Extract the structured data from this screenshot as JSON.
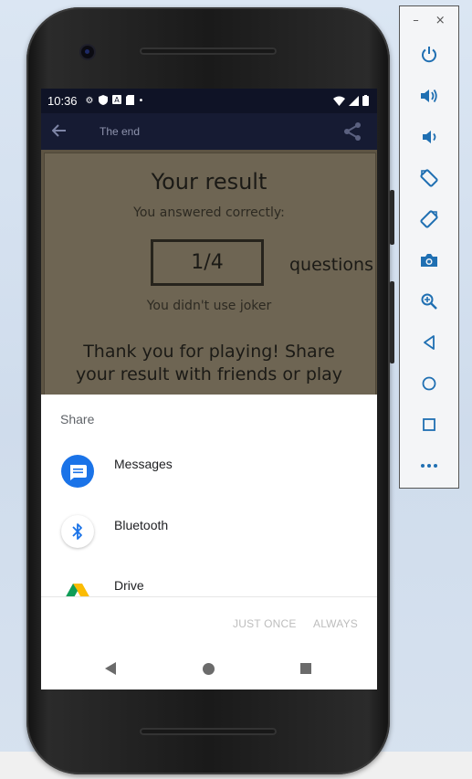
{
  "status_bar": {
    "time": "10:36"
  },
  "app_bar": {
    "title": "The end",
    "back_icon": "arrow-left-icon",
    "share_icon": "share-icon"
  },
  "result": {
    "title": "Your result",
    "answered_text": "You answered correctly:",
    "score": "1/4",
    "questions_label": "questions",
    "joker_text": "You didn't use joker",
    "thanks_text": "Thank you for playing! Share your result with friends or play"
  },
  "share_sheet": {
    "title": "Share",
    "items": [
      {
        "label": "Messages",
        "icon": "messages-icon"
      },
      {
        "label": "Bluetooth",
        "icon": "bluetooth-icon"
      },
      {
        "label": "Drive",
        "icon": "drive-icon"
      }
    ],
    "just_once": "JUST ONCE",
    "always": "ALWAYS"
  },
  "emulator_toolbar": {
    "minimize": "–",
    "close": "×",
    "buttons": [
      "power-icon",
      "volume-up-icon",
      "volume-down-icon",
      "rotate-left-icon",
      "rotate-right-icon",
      "camera-icon",
      "zoom-icon",
      "back-icon",
      "home-icon",
      "overview-icon",
      "more-icon"
    ]
  },
  "colors": {
    "app_bar": "#161b33",
    "content_dim": "#6e6553",
    "accent_blue": "#1a73e8"
  }
}
